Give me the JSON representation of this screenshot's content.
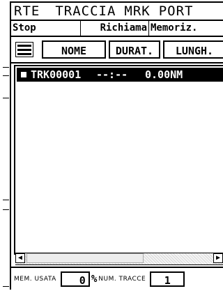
{
  "menubar": {
    "items": [
      "RTE",
      "TRACCIA",
      "MRK",
      "PORT"
    ]
  },
  "commands": {
    "stop": "Stop",
    "recall": "Richiama",
    "memorize": "Memoriz."
  },
  "columns": {
    "icon": "list-view-icon",
    "name": "NOME",
    "duration": "DURAT.",
    "length": "LUNGH."
  },
  "tracks": [
    {
      "name": "TRK00001",
      "duration": "--:--",
      "length": "0.00NM",
      "selected": true
    }
  ],
  "status": {
    "mem_label": "MEM. USATA",
    "mem_value": "0",
    "mem_unit": "%",
    "count_label": "NUM. TRACCE",
    "count_value": "1"
  },
  "scroll_icons": {
    "left": "arrow-left-icon",
    "right": "arrow-right-icon"
  }
}
